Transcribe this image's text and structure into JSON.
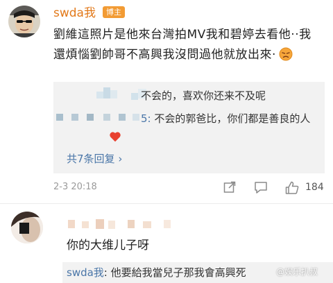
{
  "post": {
    "username": "swda我",
    "badge": "博主",
    "text": "劉維這照片是他來台灣拍MV我和碧婷去看他‧‧我還煩惱劉帥哥不高興我沒問過他就放出來‧",
    "emoji": "unamused-face"
  },
  "replies": {
    "line1_text": "不会的，喜欢你还来不及呢",
    "line2_suffix": "5:",
    "line2_text": "不会的郭爸比，你们都是善良的人",
    "line2_emoji": "red-heart",
    "more_label": "共7条回复"
  },
  "meta": {
    "date": "2-3 20:18",
    "like_count": "184"
  },
  "comment2": {
    "text": "你的大维儿子呀",
    "reply_author": "swda我",
    "reply_text": ": 他要給我當兒子那我會高興死",
    "watermark": "@娱乐扒叔"
  },
  "colors": {
    "username": "#e2791a",
    "badge_bg": "#f29b34",
    "link": "#4a76a8",
    "reply_bg": "#f2f2f2"
  }
}
